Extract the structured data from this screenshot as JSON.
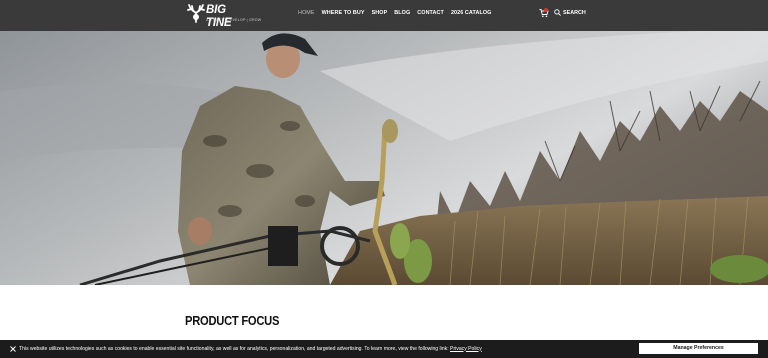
{
  "header": {
    "logo_text": "BIG TINE",
    "logo_tagline": "ATTRACT | DEVELOP | GROW",
    "nav": [
      {
        "label": "HOME",
        "active": true
      },
      {
        "label": "WHERE TO BUY",
        "active": false
      },
      {
        "label": "SHOP",
        "active": false
      },
      {
        "label": "BLOG",
        "active": false
      },
      {
        "label": "CONTACT",
        "active": false
      },
      {
        "label": "2026 CATALOG",
        "active": false
      }
    ],
    "cart_icon": "cart-icon",
    "search_label": "SEARCH",
    "search_icon": "search-icon"
  },
  "hero": {
    "image_description_icon": "hero-photo"
  },
  "main": {
    "section_title": "PRODUCT FOCUS"
  },
  "cookie_banner": {
    "close_icon": "close-icon",
    "text": "This website utilizes technologies such as cookies to enable essential site functionality, as well as for analytics, personalization, and targeted advertising. To learn more, view the following link:",
    "link_text": "Privacy Policy",
    "button_label": "Manage Preferences"
  },
  "colors": {
    "header_bg": "#3a3a3a",
    "cookie_bg": "#1c1c1c",
    "badge": "#d8352a"
  }
}
